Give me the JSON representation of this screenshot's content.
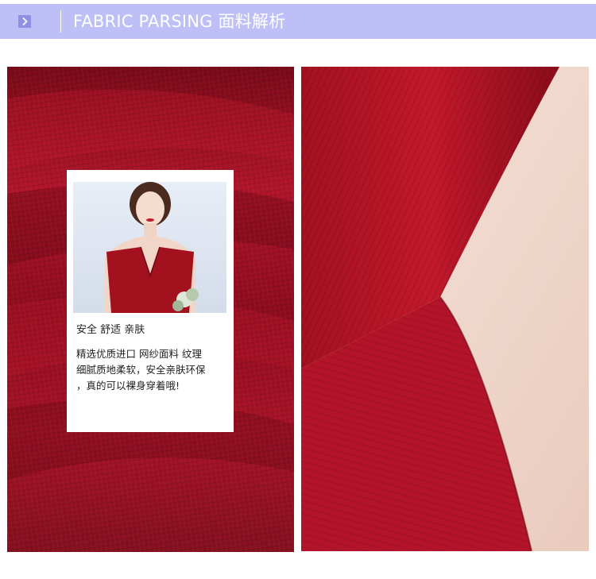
{
  "header": {
    "title": "FABRIC PARSING 面料解析",
    "bar_color": "#bfbff7",
    "icon": "chevron-right-icon"
  },
  "info_card": {
    "heading": "安全 舒适 亲肤",
    "body_lines": [
      "精选优质进口 网纱面料 纹理",
      "细腻质地柔软，安全亲肤环保",
      "，真的可以裸身穿着哦!"
    ]
  },
  "colors": {
    "fabric_red": "#9c0f1f",
    "fabric_dark": "#6a0814",
    "skin": "#f2dcd0"
  }
}
